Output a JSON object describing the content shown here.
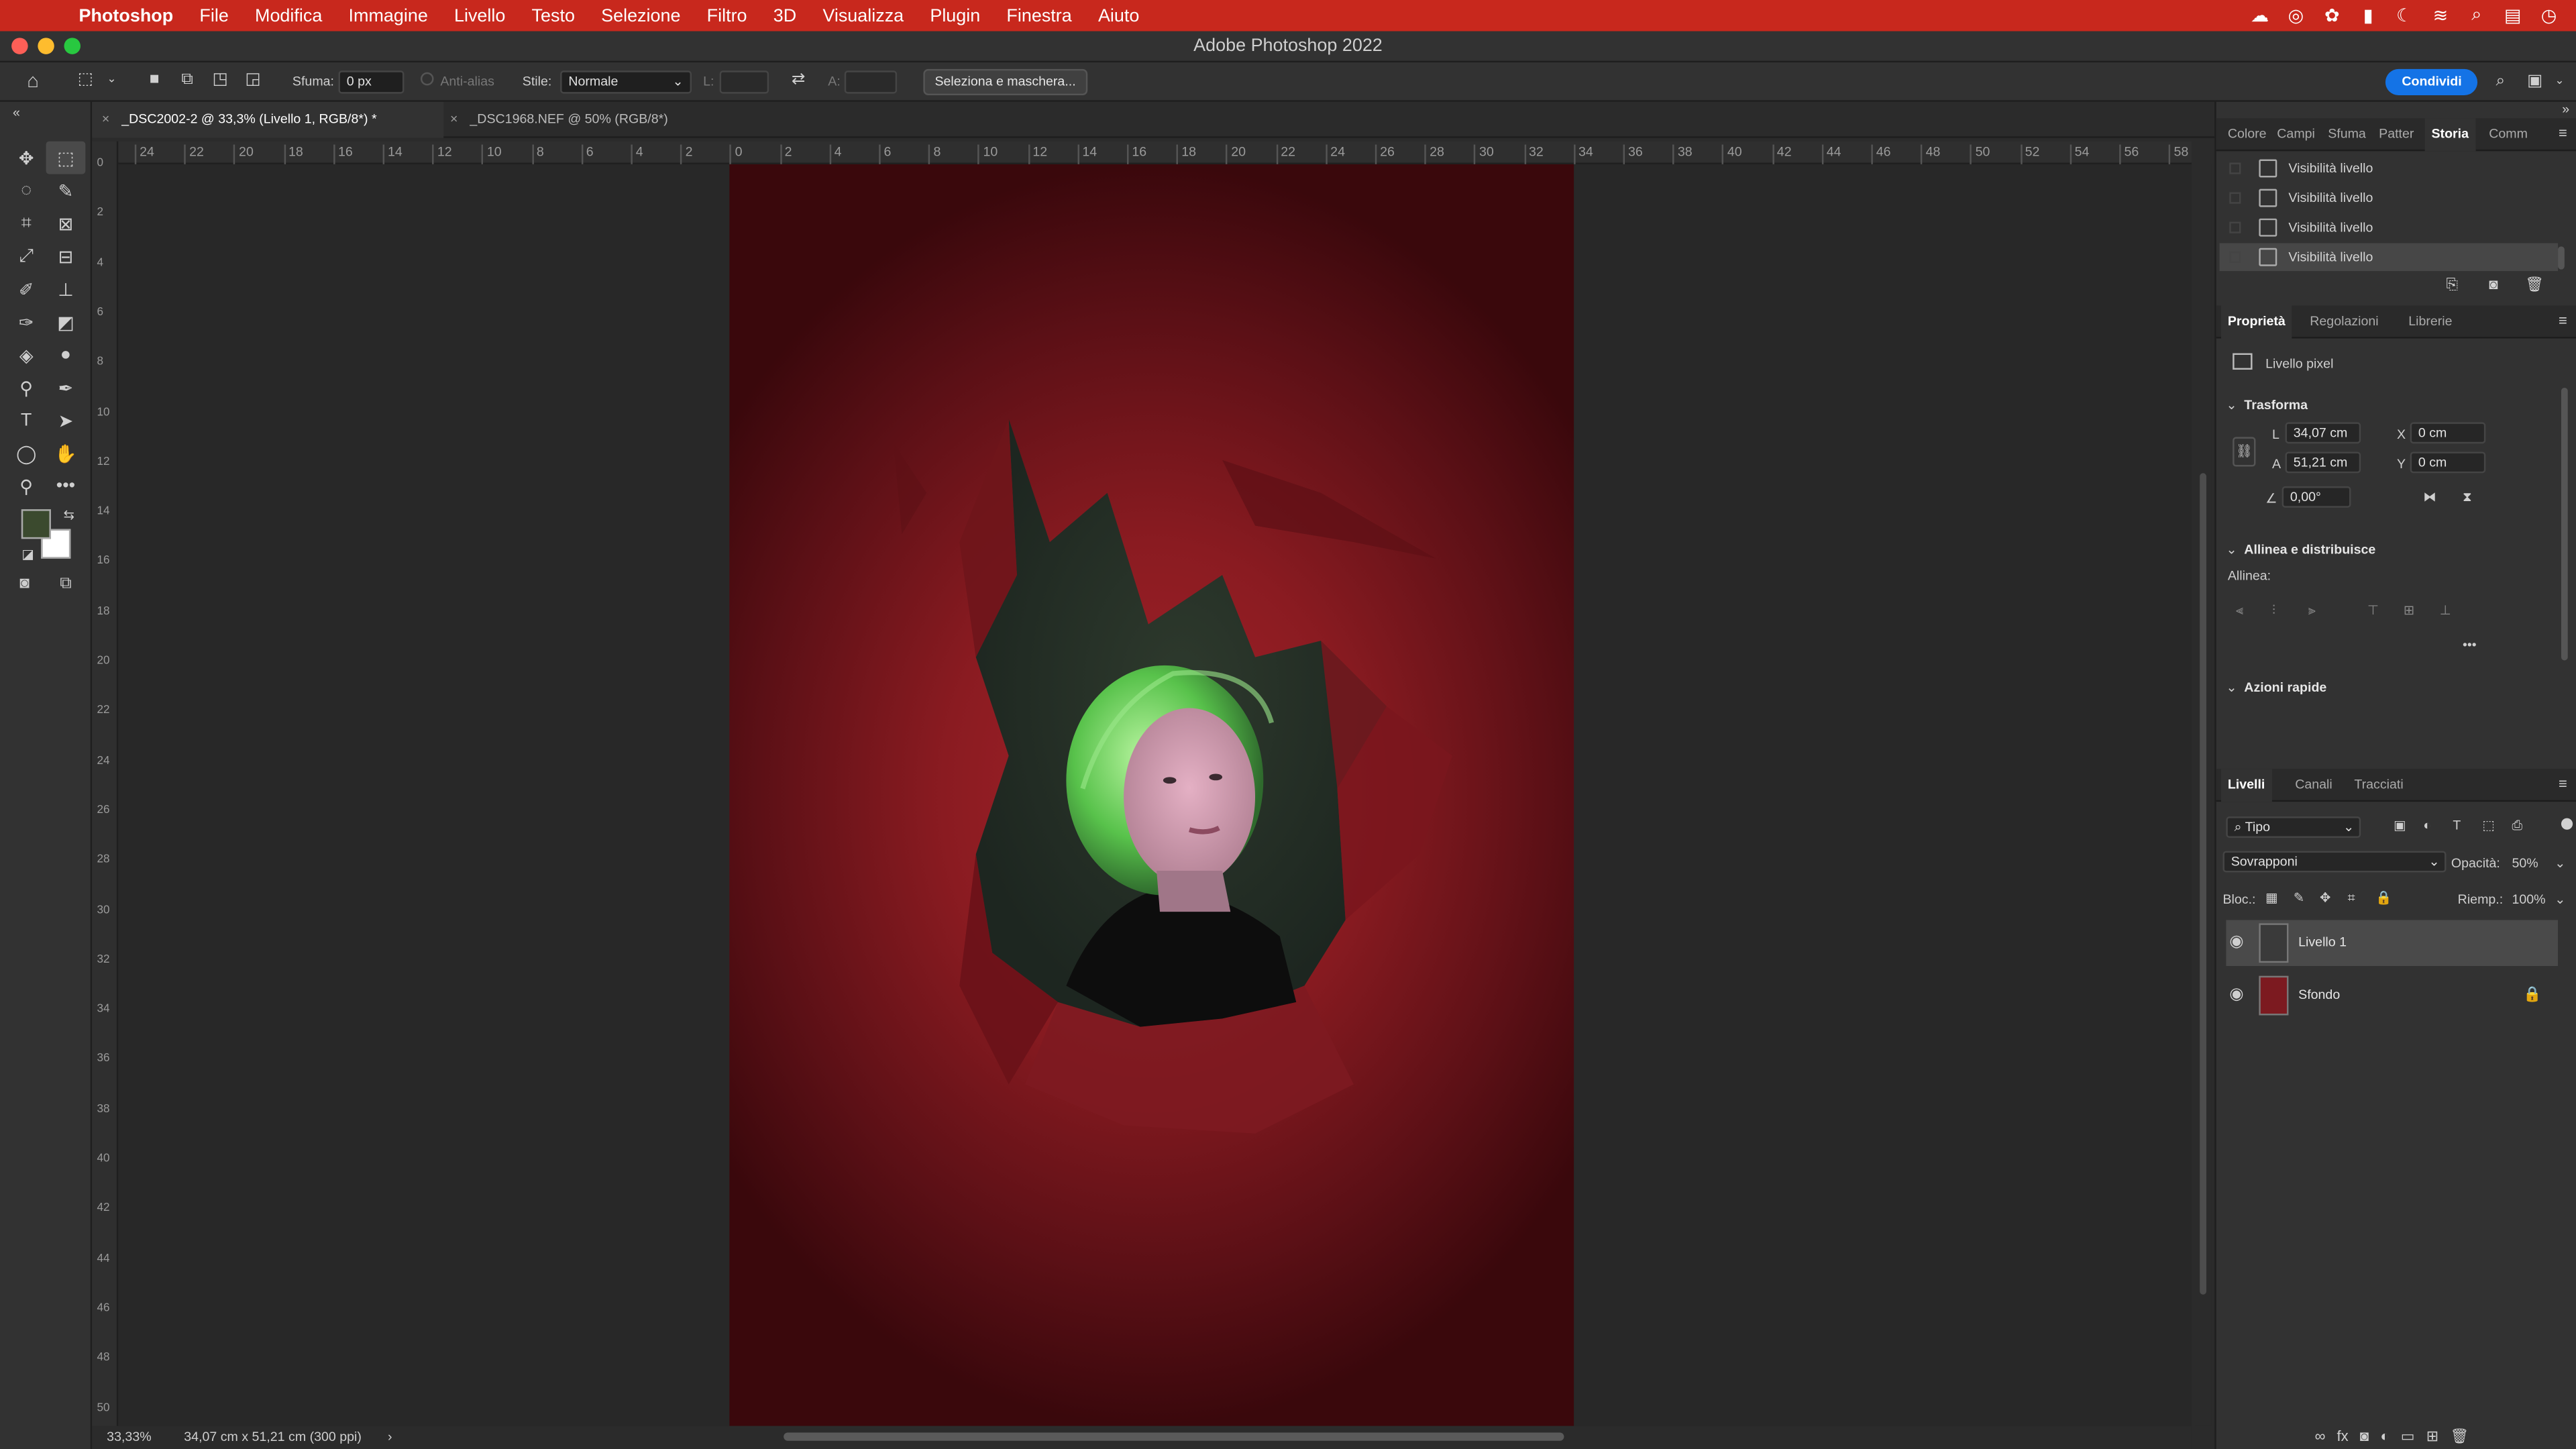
{
  "menubar": {
    "items": [
      "Photoshop",
      "File",
      "Modifica",
      "Immagine",
      "Livello",
      "Testo",
      "Selezione",
      "Filtro",
      "3D",
      "Visualizza",
      "Plugin",
      "Finestra",
      "Aiuto"
    ]
  },
  "window": {
    "title": "Adobe Photoshop 2022"
  },
  "options": {
    "feather_label": "Sfuma:",
    "feather_value": "0 px",
    "antialias_label": "Anti-alias",
    "style_label": "Stile:",
    "style_value": "Normale",
    "width_label": "L:",
    "height_label": "A:",
    "select_mask_label": "Seleziona e maschera...",
    "share_label": "Condividi"
  },
  "tabs": [
    {
      "label": "_DSC2002-2 @ 33,3% (Livello 1, RGB/8*) *"
    },
    {
      "label": "_DSC1968.NEF @ 50% (RGB/8*)"
    }
  ],
  "rulers": {
    "horizontal": [
      "24",
      "22",
      "20",
      "18",
      "16",
      "14",
      "12",
      "10",
      "8",
      "6",
      "4",
      "2",
      "0",
      "2",
      "4",
      "6",
      "8",
      "10",
      "12",
      "14",
      "16",
      "18",
      "20",
      "22",
      "24",
      "26",
      "28",
      "30",
      "32",
      "34",
      "36",
      "38",
      "40",
      "42",
      "44",
      "46",
      "48",
      "50",
      "52",
      "54",
      "56",
      "58"
    ],
    "vertical": [
      "0",
      "2",
      "4",
      "6",
      "8",
      "10",
      "12",
      "14",
      "16",
      "18",
      "20",
      "22",
      "24",
      "26",
      "28",
      "30",
      "32",
      "34",
      "36",
      "38",
      "40",
      "42",
      "44",
      "46",
      "48",
      "50"
    ]
  },
  "status": {
    "zoom": "33,33%",
    "doc_size": "34,07 cm x 51,21 cm (300 ppi)",
    "arrow": "›"
  },
  "top_panel": {
    "tabs": [
      "Colore",
      "Campi",
      "Sfuma",
      "Patter",
      "Storia",
      "Comm"
    ],
    "active": "Storia",
    "history": [
      "Visibilità livello",
      "Visibilità livello",
      "Visibilità livello",
      "Visibilità livello"
    ]
  },
  "properties": {
    "tabs": [
      "Proprietà",
      "Regolazioni",
      "Librerie"
    ],
    "kind": "Livello pixel",
    "transform_title": "Trasforma",
    "w_label": "L",
    "w_value": "34,07 cm",
    "h_label": "A",
    "h_value": "51,21 cm",
    "x_label": "X",
    "x_value": "0 cm",
    "y_label": "Y",
    "y_value": "0 cm",
    "angle_value": "0,00°",
    "align_title": "Allinea e distribuisce",
    "align_label": "Allinea:",
    "more": "•••",
    "quick_title": "Azioni rapide"
  },
  "layers_panel": {
    "tabs": [
      "Livelli",
      "Canali",
      "Tracciati"
    ],
    "filter_value": "Tipo",
    "blend_mode": "Sovrapponi",
    "opacity_label": "Opacità:",
    "opacity_value": "50%",
    "lock_label": "Bloc.:",
    "fill_label": "Riemp.:",
    "fill_value": "100%",
    "layers": [
      {
        "name": "Livello 1",
        "selected": true
      },
      {
        "name": "Sfondo",
        "selected": false
      }
    ]
  },
  "colors": {
    "menubar": "#c8281d",
    "foreground": "#3b4a2e",
    "background": "#ffffff",
    "accent": "#1473e6"
  }
}
